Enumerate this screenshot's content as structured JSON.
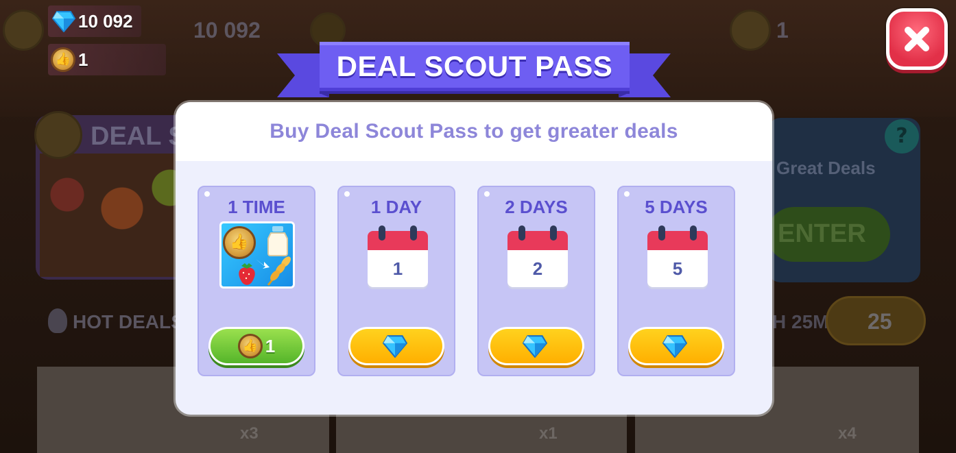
{
  "hud": {
    "gems": "10 092",
    "deal_coins": "1"
  },
  "background": {
    "gems_ghost": "10 092",
    "coins_ghost": "1",
    "panel_title": "DEAL SC",
    "great_deals": "Great Deals",
    "enter": "ENTER",
    "hot_deals": "HOT DEALS",
    "timer": "H 25M",
    "refresh_cost": "25",
    "qty_1": "x3",
    "qty_2": "x1",
    "qty_3": "x4",
    "help": "?"
  },
  "modal": {
    "title": "DEAL SCOUT PASS",
    "subtitle": "Buy Deal Scout Pass to get greater deals",
    "cards": [
      {
        "label": "1 TIME",
        "button_value": "1",
        "button_color": "#55b52a"
      },
      {
        "label": "1 DAY",
        "calendar_number": "1",
        "button_value": "",
        "button_color": "#ffaf00"
      },
      {
        "label": "2 DAYS",
        "calendar_number": "2",
        "button_value": "",
        "button_color": "#ffaf00"
      },
      {
        "label": "5 DAYS",
        "calendar_number": "5",
        "button_value": "",
        "button_color": "#ffaf00"
      }
    ]
  },
  "icons": {
    "gem": "diamond-icon",
    "coin": "thumbs-up-coin-icon",
    "close": "close-x-icon",
    "calendar": "calendar-icon"
  },
  "colors": {
    "banner": "#6e5ef2",
    "close_button": "#e23048",
    "card_bg": "#c6c5f5",
    "subtitle": "#8d86d9"
  }
}
